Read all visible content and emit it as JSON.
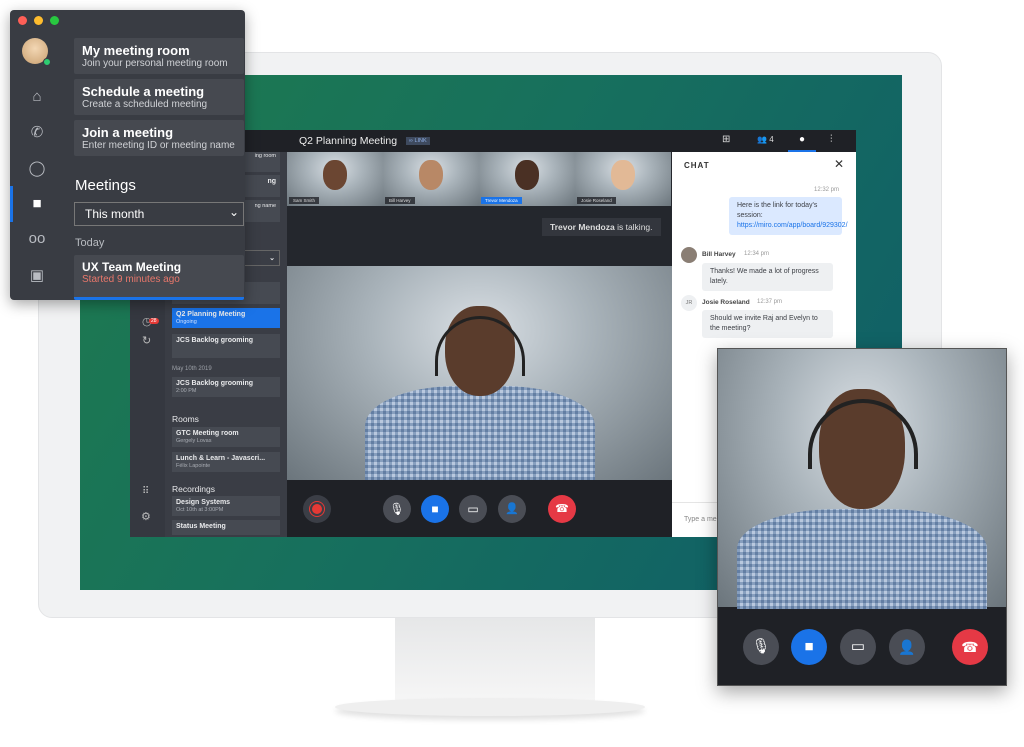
{
  "overlay_menu": {
    "window_controls": [
      "close",
      "minimize",
      "maximize"
    ],
    "nav_icons": [
      "home-icon",
      "phone-icon",
      "chat-icon",
      "video-icon",
      "voicemail-icon",
      "contacts-icon"
    ],
    "actions": [
      {
        "title": "My meeting room",
        "subtitle": "Join your personal meeting room"
      },
      {
        "title": "Schedule a meeting",
        "subtitle": "Create a scheduled meeting"
      },
      {
        "title": "Join a meeting",
        "subtitle": "Enter meeting ID or meeting name"
      }
    ],
    "meetings_heading": "Meetings",
    "filter_value": "This month",
    "today_label": "Today",
    "today_meeting": {
      "title": "UX Team Meeting",
      "status": "Started 9 minutes ago"
    },
    "status_color": "#e8776b"
  },
  "app": {
    "meeting_title": "Q2 Planning Meeting",
    "link_badge": "LINK",
    "participants_count": "4",
    "toolbar_icons": [
      "grid-icon",
      "participants-icon",
      "chat-icon",
      "settings-sliders-icon"
    ],
    "sidebar": {
      "badge_count": "28",
      "partial_items": [
        "ing room",
        "ng",
        "ng name"
      ],
      "current": [
        {
          "title": "Q2 Planning Meeting",
          "subtitle": "Ongoing",
          "active": true
        },
        {
          "title": "JCS Backlog grooming",
          "subtitle": ""
        }
      ],
      "date_label": "May 10th 2019",
      "dated": [
        {
          "title": "JCS Backlog grooming",
          "subtitle": "2:00 PM"
        }
      ],
      "rooms_heading": "Rooms",
      "rooms": [
        {
          "title": "GTC Meeting room",
          "subtitle": "Gergely Lovas"
        },
        {
          "title": "Lunch & Learn - Javascri...",
          "subtitle": "Félix Lapointe"
        }
      ],
      "recordings_heading": "Recordings",
      "recordings": [
        {
          "title": "Design Systems",
          "subtitle": "Oct 10th at 3:00PM"
        },
        {
          "title": "Status Meeting",
          "subtitle": ""
        }
      ]
    },
    "thumbnails": [
      {
        "name": "Sam Smith"
      },
      {
        "name": "Bill Harvey"
      },
      {
        "name": "Trevor Mendoza",
        "speaking": true
      },
      {
        "name": "Josie Roseland"
      }
    ],
    "talking": {
      "name": "Trevor Mendoza",
      "suffix": " is talking."
    },
    "controls": [
      "record-icon",
      "mic-off-icon",
      "video-icon",
      "share-screen-off-icon",
      "add-person-icon",
      "hang-up-icon"
    ],
    "accent": "#1a73e8",
    "chat": {
      "title": "CHAT",
      "messages": [
        {
          "time": "12:32 pm",
          "text": "Here is the link for today's session: ",
          "link": "https://miro.com/app/board/929302/",
          "own": true
        },
        {
          "author": "Bill Harvey",
          "time": "12:34 pm",
          "text": "Thanks! We made a lot of progress lately."
        },
        {
          "author": "Josie Roseland",
          "initials": "JR",
          "time": "12:37 pm",
          "text": "Should we invite Raj and Evelyn to the meeting?"
        }
      ],
      "input_placeholder": "Type a me"
    }
  }
}
